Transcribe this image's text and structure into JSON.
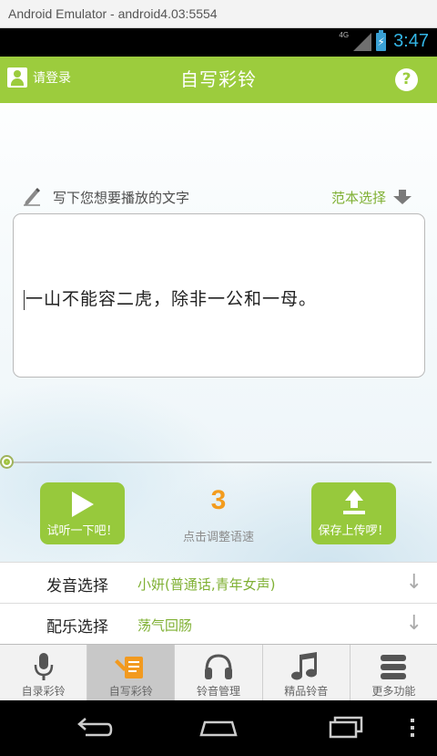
{
  "window": {
    "title": "Android Emulator - android4.03:5554"
  },
  "status_bar": {
    "network": "4G",
    "time": "3:47"
  },
  "header": {
    "login_label": "请登录",
    "title": "自写彩铃",
    "help_label": "?"
  },
  "editor": {
    "prompt": "写下您想要播放的文字",
    "sample_label": "范本选择",
    "text": "一山不能容二虎，除非一公和一母。"
  },
  "controls": {
    "play_label": "试听一下吧！",
    "speed_value": "3",
    "speed_hint": "点击调整语速",
    "upload_label": "保存上传啰！"
  },
  "options": [
    {
      "key": "发音选择",
      "value": "小妍(普通话,青年女声)",
      "arrow": "↓"
    },
    {
      "key": "配乐选择",
      "value": "荡气回肠",
      "arrow": "↓"
    }
  ],
  "tabs": [
    {
      "label": "自录彩铃",
      "icon": "microphone-icon"
    },
    {
      "label": "自写彩铃",
      "icon": "write-icon",
      "active": true
    },
    {
      "label": "铃音管理",
      "icon": "headphones-icon"
    },
    {
      "label": "精品铃音",
      "icon": "music-note-icon"
    },
    {
      "label": "更多功能",
      "icon": "more-list-icon"
    }
  ],
  "colors": {
    "brand_green": "#9ccc3d",
    "accent_orange": "#f39c1e",
    "status_blue": "#33b5e5"
  }
}
